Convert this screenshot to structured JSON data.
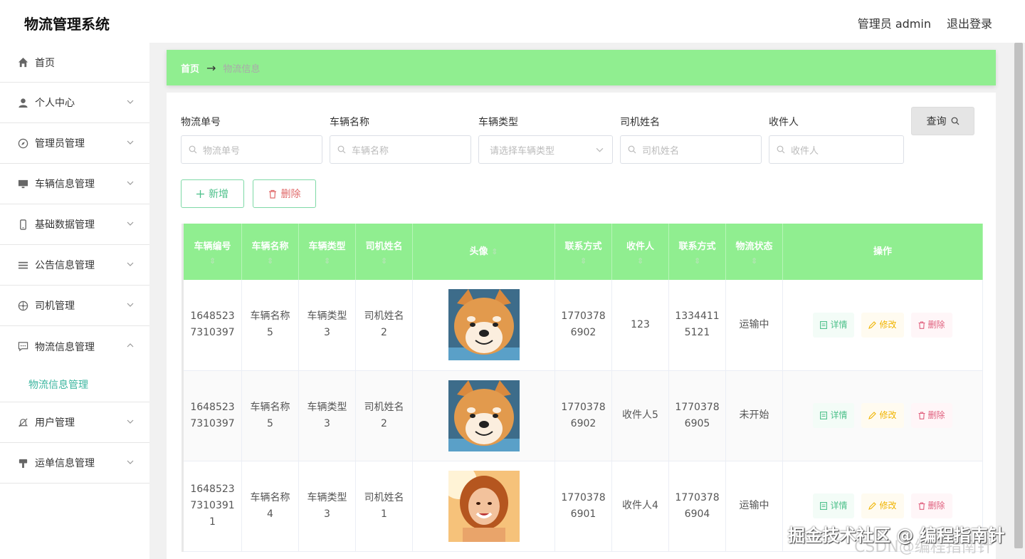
{
  "header": {
    "app_title": "物流管理系统",
    "user_label": "管理员 admin",
    "logout_label": "退出登录"
  },
  "sidebar": {
    "items": [
      {
        "label": "首页",
        "icon": "home-icon"
      },
      {
        "label": "个人中心",
        "icon": "user-icon"
      },
      {
        "label": "管理员管理",
        "icon": "compass-icon"
      },
      {
        "label": "车辆信息管理",
        "icon": "monitor-icon"
      },
      {
        "label": "基础数据管理",
        "icon": "phone-icon"
      },
      {
        "label": "公告信息管理",
        "icon": "list-icon"
      },
      {
        "label": "司机管理",
        "icon": "wheel-icon"
      },
      {
        "label": "物流信息管理",
        "icon": "chat-icon"
      },
      {
        "label": "用户管理",
        "icon": "bell-off-icon"
      },
      {
        "label": "运单信息管理",
        "icon": "stamp-icon"
      }
    ],
    "active_sub": "物流信息管理"
  },
  "breadcrumb": {
    "home": "首页",
    "arrow": "→",
    "current": "物流信息"
  },
  "filters": {
    "fields": [
      {
        "label": "物流单号",
        "placeholder": "物流单号"
      },
      {
        "label": "车辆名称",
        "placeholder": "车辆名称"
      },
      {
        "label": "车辆类型",
        "placeholder": "请选择车辆类型"
      },
      {
        "label": "司机姓名",
        "placeholder": "司机姓名"
      },
      {
        "label": "收件人",
        "placeholder": "收件人"
      }
    ],
    "query_label": "查询"
  },
  "actions": {
    "add_label": "新增",
    "delete_label": "删除"
  },
  "table": {
    "columns": [
      "车辆编号",
      "车辆名称",
      "车辆类型",
      "司机姓名",
      "头像",
      "联系方式",
      "收件人",
      "联系方式",
      "物流状态",
      "操作"
    ],
    "sort_glyph": "⇕",
    "rows": [
      {
        "id": "1648523 7310397",
        "vehicle_name": "车辆名称 5",
        "vehicle_type": "车辆类型 3",
        "driver": "司机姓名 2",
        "avatar": "shiba-dog",
        "phone": "1770378 6902",
        "recipient": "123",
        "recipient_phone": "1334411 5121",
        "status": "运输中"
      },
      {
        "id": "1648523 7310397",
        "vehicle_name": "车辆名称 5",
        "vehicle_type": "车辆类型 3",
        "driver": "司机姓名 2",
        "avatar": "shiba-dog",
        "phone": "1770378 6902",
        "recipient": "收件人5",
        "recipient_phone": "1770378 6905",
        "status": "未开始"
      },
      {
        "id": "1648523 7310391 1",
        "vehicle_name": "车辆名称 4",
        "vehicle_type": "车辆类型 3",
        "driver": "司机姓名 1",
        "avatar": "smiling-woman",
        "phone": "1770378 6901",
        "recipient": "收件人4",
        "recipient_phone": "1770378 6904",
        "status": "运输中"
      }
    ],
    "op_labels": {
      "detail": "详情",
      "edit": "修改",
      "remove": "删除"
    }
  },
  "watermark": "掘金技术社区 @ 编程指南针",
  "watermark2": "CSDN@编程指南针"
}
